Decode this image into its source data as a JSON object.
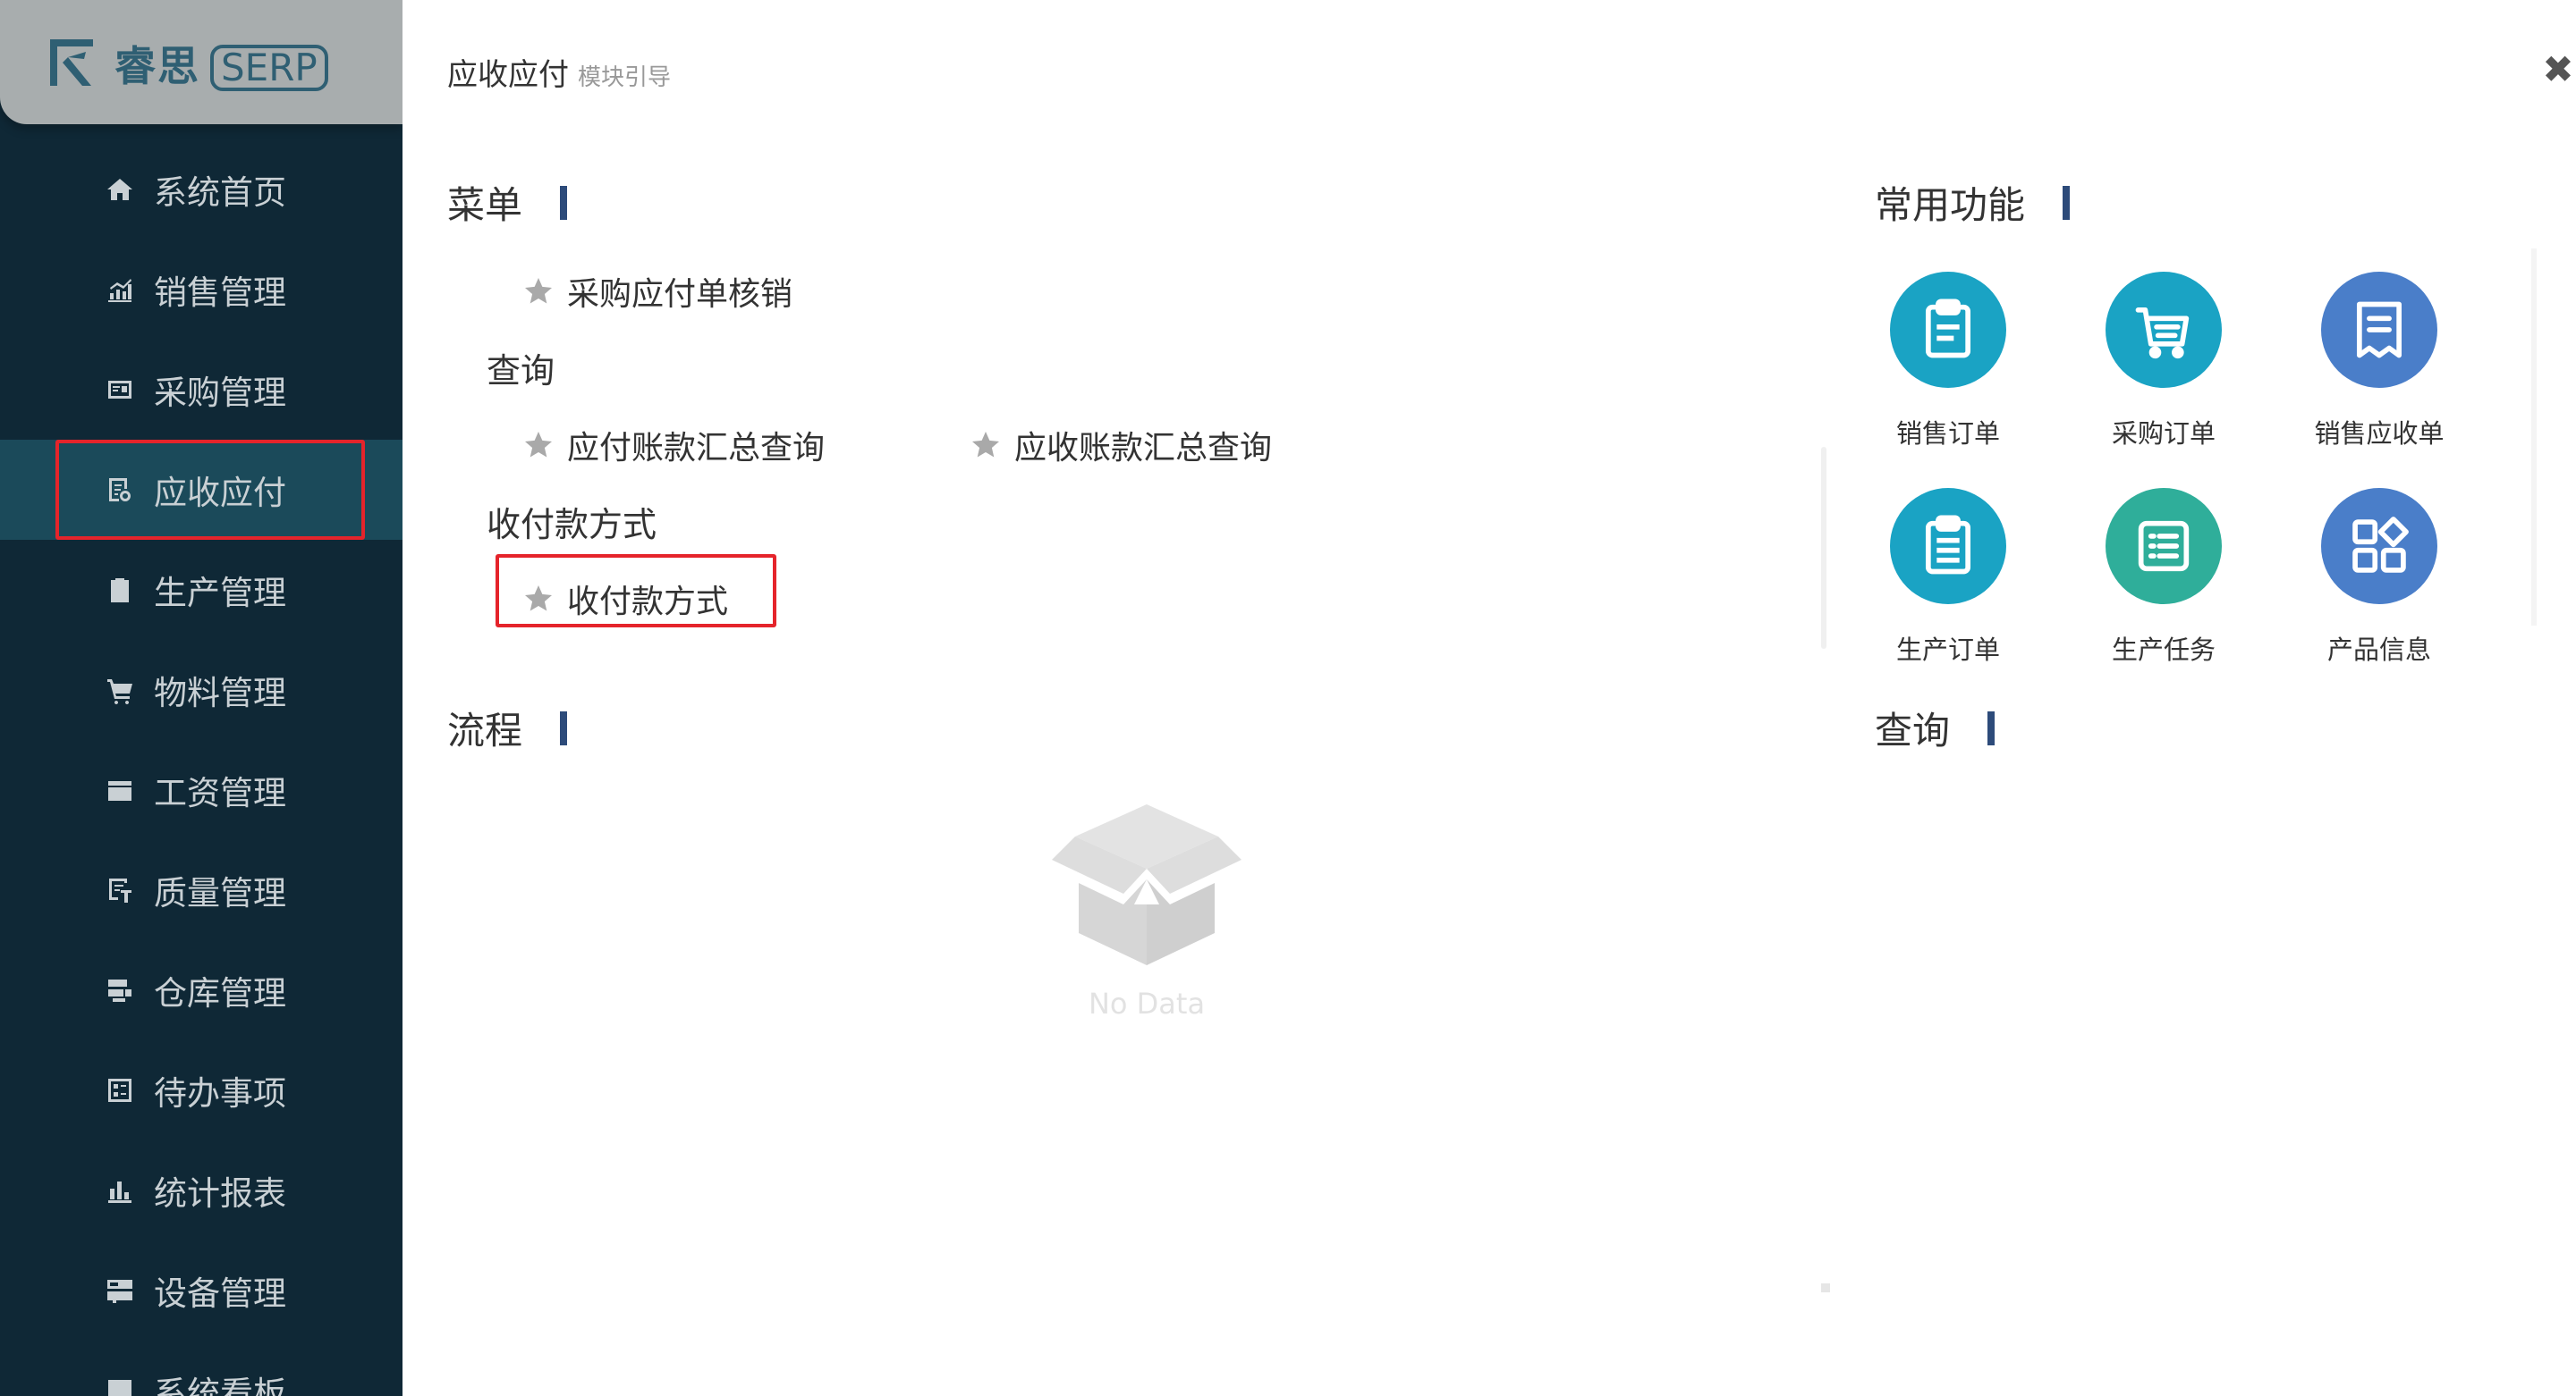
{
  "logo": {
    "name": "睿思",
    "tag": "SERP"
  },
  "sidebar": {
    "items": [
      {
        "label": "系统首页",
        "icon": "home-icon"
      },
      {
        "label": "销售管理",
        "icon": "chart-icon"
      },
      {
        "label": "采购管理",
        "icon": "invoice-icon"
      },
      {
        "label": "应收应付",
        "icon": "ledger-icon",
        "active": true
      },
      {
        "label": "生产管理",
        "icon": "clipboard-check-icon"
      },
      {
        "label": "物料管理",
        "icon": "cart-icon"
      },
      {
        "label": "工资管理",
        "icon": "calendar-icon"
      },
      {
        "label": "质量管理",
        "icon": "quality-icon"
      },
      {
        "label": "仓库管理",
        "icon": "warehouse-icon"
      },
      {
        "label": "待办事项",
        "icon": "todo-icon"
      },
      {
        "label": "统计报表",
        "icon": "bar-chart-icon"
      },
      {
        "label": "设备管理",
        "icon": "device-icon"
      },
      {
        "label": "系统看板",
        "icon": "dashboard-icon"
      }
    ]
  },
  "header": {
    "title": "应收应付",
    "subtitle": "模块引导",
    "close_icon": "close-icon"
  },
  "menu_section": {
    "title": "菜单",
    "item_payable_writeoff": "采购应付单核销",
    "group_query": "查询",
    "item_payable_summary": "应付账款汇总查询",
    "item_receivable_summary": "应收账款汇总查询",
    "group_payment": "收付款方式",
    "item_payment_method": "收付款方式"
  },
  "flow_section": {
    "title": "流程",
    "empty_text": "No Data"
  },
  "common_section": {
    "title": "常用功能",
    "items": [
      {
        "label": "销售订单",
        "color": "#1aa3c4",
        "icon": "clipboard-icon"
      },
      {
        "label": "采购订单",
        "color": "#1aa3c4",
        "icon": "cart-icon"
      },
      {
        "label": "销售应收单",
        "color": "#4a7ec9",
        "icon": "receipt-icon"
      },
      {
        "label": "生产订单",
        "color": "#1aa3c4",
        "icon": "clipboard-icon"
      },
      {
        "label": "生产任务",
        "color": "#2fae9a",
        "icon": "list-icon"
      },
      {
        "label": "产品信息",
        "color": "#4a7ec9",
        "icon": "grid-icon"
      }
    ]
  },
  "query_section": {
    "title": "查询"
  }
}
